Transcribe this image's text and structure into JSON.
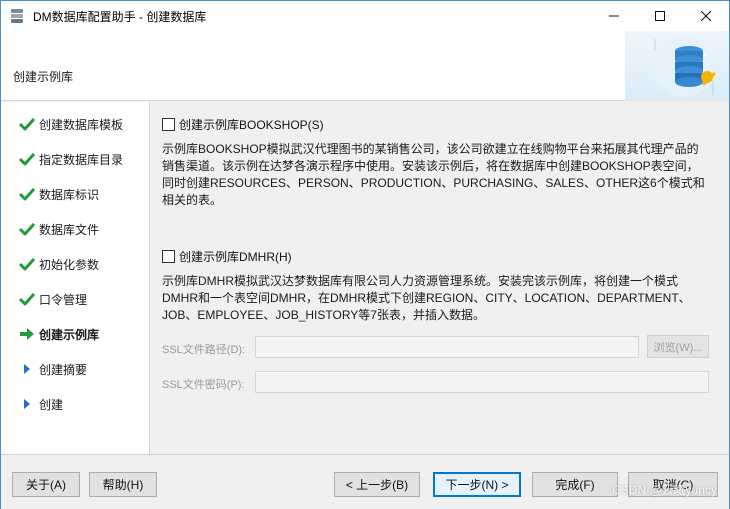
{
  "window": {
    "title": "DM数据库配置助手 - 创建数据库"
  },
  "header": {
    "title": "创建示例库"
  },
  "steps": [
    {
      "label": "创建数据库模板",
      "state": "done"
    },
    {
      "label": "指定数据库目录",
      "state": "done"
    },
    {
      "label": "数据库标识",
      "state": "done"
    },
    {
      "label": "数据库文件",
      "state": "done"
    },
    {
      "label": "初始化参数",
      "state": "done"
    },
    {
      "label": "口令管理",
      "state": "done"
    },
    {
      "label": "创建示例库",
      "state": "current"
    },
    {
      "label": "创建摘要",
      "state": "pending"
    },
    {
      "label": "创建",
      "state": "pending"
    }
  ],
  "bookshop": {
    "checkbox_label": "创建示例库BOOKSHOP(S)",
    "checked": false,
    "desc_lines": [
      "示例库BOOKSHOP模拟武汉代理图书的某销售公司，该公司欲建立在线购物平台来拓展其代理产品的",
      "销售渠道。该示例在达梦各演示程序中使用。安装该示例后，将在数据库中创建BOOKSHOP表空间，",
      "同时创建RESOURCES、PERSON、PRODUCTION、PURCHASING、SALES、OTHER这6个模式和",
      "相关的表。"
    ]
  },
  "dmhr": {
    "checkbox_label": "创建示例库DMHR(H)",
    "checked": false,
    "desc_lines": [
      "示例库DMHR模拟武汉达梦数据库有限公司人力资源管理系统。安装完该示例库，将创建一个模式",
      "DMHR和一个表空间DMHR，在DMHR模式下创建REGION、CITY、LOCATION、DEPARTMENT、",
      "JOB、EMPLOYEE、JOB_HISTORY等7张表，并插入数据。"
    ]
  },
  "ssl": {
    "path_label": "SSL文件路径(D):",
    "path_value": "",
    "browse_label": "浏览(W)...",
    "password_label": "SSL文件密码(P):",
    "password_value": ""
  },
  "footer": {
    "about_label": "关于(A)",
    "help_label": "帮助(H)",
    "prev_label": "< 上一步(B)",
    "next_label": "下一步(N) >",
    "finish_label": "完成(F)",
    "cancel_label": "取消(C)"
  },
  "watermark": "CSDN @云曦yuncy",
  "colors": {
    "check_green": "#1f9c3a",
    "arrow_green": "#1f9c3a",
    "pending_blue": "#2b6cc4",
    "accent": "#0078d7"
  }
}
